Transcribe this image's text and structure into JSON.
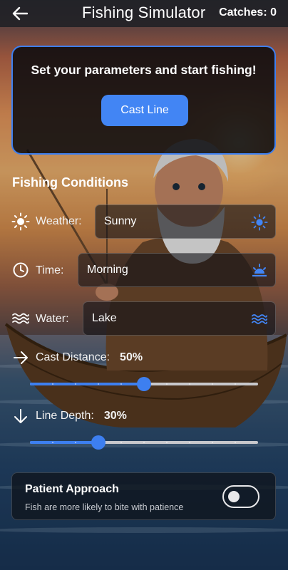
{
  "header": {
    "title": "Fishing Simulator",
    "catches": "Catches: 0"
  },
  "start_card": {
    "heading": "Set your parameters and start fishing!",
    "cast_button": "Cast Line"
  },
  "conditions": {
    "title": "Fishing Conditions",
    "weather": {
      "label": "Weather:",
      "value": "Sunny",
      "icon": "sun-icon"
    },
    "time": {
      "label": "Time:",
      "value": "Morning",
      "icon": "clock-icon",
      "value_icon": "sunrise-icon"
    },
    "water": {
      "label": "Water:",
      "value": "Lake",
      "icon": "waves-icon"
    }
  },
  "sliders": {
    "cast_distance": {
      "label": "Cast Distance:",
      "value": "50%",
      "fraction": 0.5
    },
    "line_depth": {
      "label": "Line Depth:",
      "value": "30%",
      "fraction": 0.3
    }
  },
  "patient": {
    "title": "Patient Approach",
    "subtitle": "Fish are more likely to bite with patience",
    "enabled": false
  },
  "colors": {
    "accent": "#4285f4",
    "card_border": "#3d7ff0",
    "topbar": "#222226"
  }
}
